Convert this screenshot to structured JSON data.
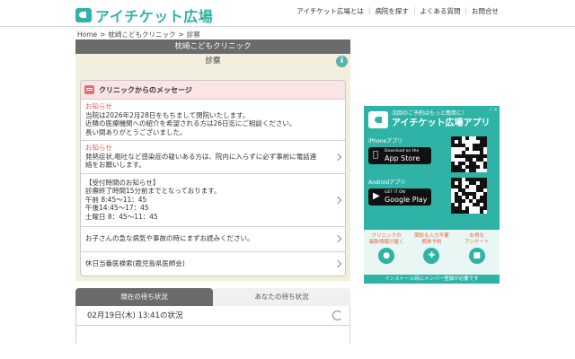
{
  "header": {
    "logo_text": "アイチケット広場",
    "nav": [
      "アイチケット広場とは",
      "病院を探す",
      "よくある質問",
      "お問合せ"
    ]
  },
  "breadcrumb": {
    "home": "Home",
    "sep": ">",
    "clinic": "枕崎こどもクリニック",
    "current": "診察"
  },
  "clinic": {
    "name": "枕崎こどもクリニック",
    "section": "診察",
    "info_icon_glyph": "i"
  },
  "messages": {
    "title": "クリニックからのメッセージ",
    "items": [
      {
        "label": "お知らせ",
        "lines": [
          "当院は2026年2月28日をもちまして閉院いたします。",
          "近隣の医療機関への紹介を希望される方は26日迄にご相談ください。",
          "長い間ありがとうございました。"
        ]
      },
      {
        "label": "お知らせ",
        "lines": [
          "発熱症状,嘔吐など感染症の疑いある方は、院内に入らずに必ず事前に電話連",
          "絡をお願いします。"
        ]
      },
      {
        "label": "",
        "lines": [
          "【受付時間のお知らせ】",
          "診療終了時間15分前までとなっております。",
          "午前 8:45〜11：45",
          "午後14:45〜17：45",
          "土曜日 8：45〜11：45"
        ]
      },
      {
        "label": "",
        "lines": [
          "お子さんの急な病気や事故の時にまずお読みください。"
        ]
      },
      {
        "label": "",
        "lines": [
          "休日当番医検索(鹿児島県医師会)"
        ]
      }
    ]
  },
  "tabs": {
    "current": "現在の待ち状況",
    "yours": "あなたの待ち状況"
  },
  "status": {
    "datetime_label": "02月19日(木) 13:41の状況"
  },
  "ad": {
    "corner": "i ×",
    "tagline": "次回のご予約はもっと簡単に！",
    "app_name": "アイチケット広場アプリ",
    "iphone_label": "iPhoneアプリ",
    "appstore_small": "Download on the",
    "appstore_big": "App Store",
    "android_label": "Androidアプリ",
    "gplay_small": "GET IT ON",
    "gplay_big": "Google Play",
    "features": [
      {
        "top": "クリニックの",
        "bottom": "最新情報が届く"
      },
      {
        "top": "問診も入力不要",
        "bottom": "簡単予約"
      },
      {
        "top": "お得な",
        "bottom": "アンケート"
      }
    ],
    "footer": "インストール時にメンバー登録が必要です"
  }
}
